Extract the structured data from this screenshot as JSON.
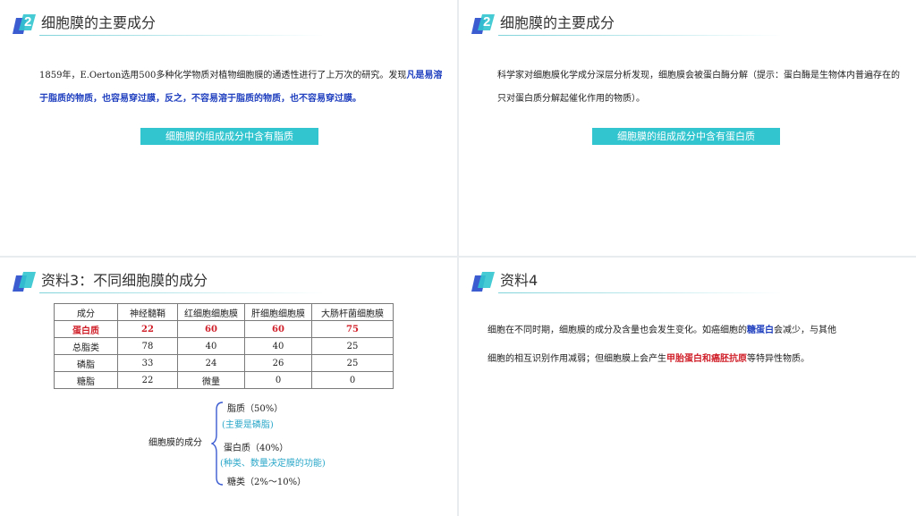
{
  "slides": [
    {
      "header_num": "2",
      "title": "细胞膜的主要成分",
      "para_lead": "1859年，E.Oerton选用500多种化学物质对植物细胞膜的通透性进行了上万次的研究。发现",
      "para_emph": "凡是易溶于脂质的物质，也容易穿过膜，反之，不容易溶于脂质的物质，也不容易穿过膜。",
      "conclusion": "细胞膜的组成成分中含有脂质"
    },
    {
      "header_num": "2",
      "title": "细胞膜的主要成分",
      "para": "科学家对细胞膜化学成分深层分析发现，细胞膜会被蛋白酶分解（提示：蛋白酶是生物体内普遍存在的只对蛋白质分解起催化作用的物质）。",
      "conclusion": "细胞膜的组成成分中含有蛋白质"
    },
    {
      "title": "资料3：不同细胞膜的成分",
      "table": {
        "headers": [
          "成分",
          "神经髓鞘",
          "红细胞细胞膜",
          "肝细胞细胞膜",
          "大肠杆菌细胞膜"
        ],
        "rows": [
          [
            "蛋白质",
            "22",
            "60",
            "60",
            "75"
          ],
          [
            "总脂类",
            "78",
            "40",
            "40",
            "25"
          ],
          [
            "磷脂",
            "33",
            "24",
            "26",
            "25"
          ],
          [
            "糖脂",
            "22",
            "微量",
            "0",
            "0"
          ]
        ]
      },
      "summary": {
        "root": "细胞膜的成分",
        "lipid": "脂质（50%）",
        "lipid_note": "(主要是磷脂)",
        "protein": "蛋白质（40%）",
        "protein_note": "(种类、数量决定膜的功能)",
        "sugar": "糖类（2%～10%）"
      }
    },
    {
      "title": "资料4",
      "p1_a": "细胞在不同时期，细胞膜的成分及含量也会发生变化。如癌细胞的",
      "p1_b": "糖蛋白",
      "p1_c": "会减少，与其他",
      "p2_a": "细胞的相互识别作用减弱；但细胞膜上会产生",
      "p2_b": "甲胎蛋白和癌胚抗原",
      "p2_c": "等特异性物质。"
    }
  ],
  "colors": {
    "icon_dark": "#3b5bd1",
    "icon_light": "#32c5cf",
    "tag_bg": "#32c5cf",
    "emph_blue": "#1f3fbf",
    "emph_red": "#d0202a"
  }
}
